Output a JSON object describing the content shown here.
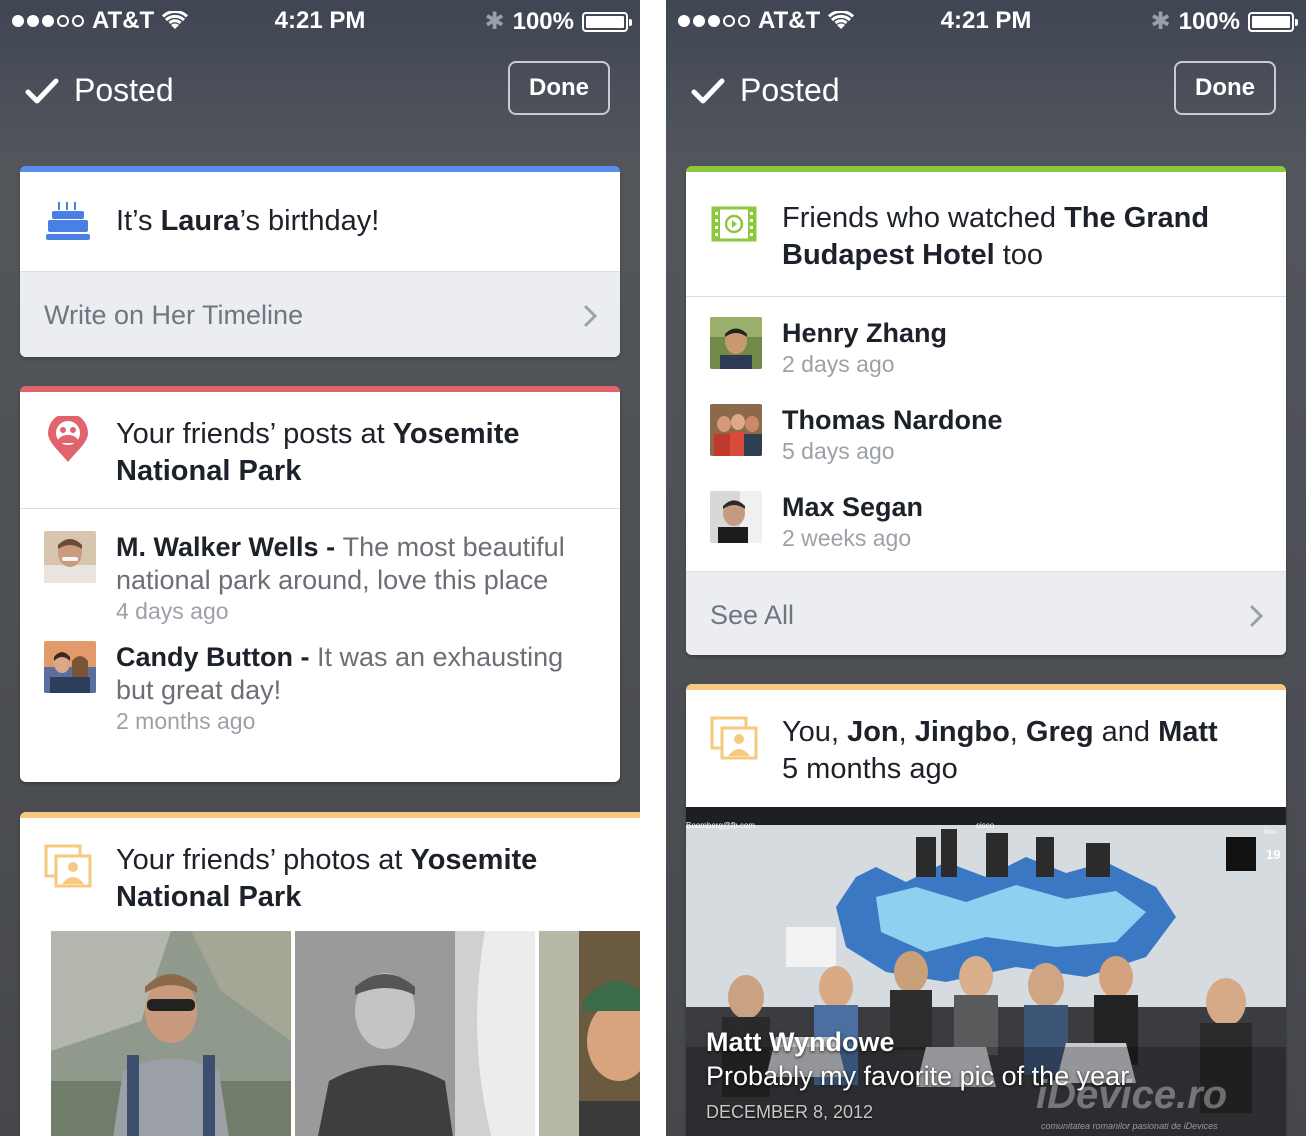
{
  "status_bar": {
    "carrier": "AT&T",
    "time": "4:21 PM",
    "battery": "100%",
    "signal_bars_filled": 3,
    "signal_bars_total": 5
  },
  "navbar": {
    "title": "Posted",
    "done_label": "Done"
  },
  "left": {
    "birthday_card": {
      "accent": "#5b8def",
      "prefix": "It’s ",
      "name": "Laura",
      "suffix": "’s birthday!",
      "action": "Write on Her Timeline"
    },
    "posts_card": {
      "accent": "#e0636d",
      "prefix": "Your friends’ posts at ",
      "place": "Yosemite National Park",
      "posts": [
        {
          "name": "M. Walker Wells",
          "text": "The most beautiful national park around, love this place",
          "time": "4 days ago"
        },
        {
          "name": "Candy Button",
          "text": "It was an exhausting but great day!",
          "time": "2 months ago"
        }
      ]
    },
    "photos_card": {
      "accent": "#f6c97f",
      "prefix": "Your friends’ photos at ",
      "place": "Yosemite National Park"
    }
  },
  "right": {
    "movie_card": {
      "accent": "#8cc83c",
      "prefix": "Friends who watched ",
      "movie": "The Grand Budapest Hotel",
      "suffix": " too",
      "friends": [
        {
          "name": "Henry Zhang",
          "time": "2 days ago"
        },
        {
          "name": "Thomas Nardone",
          "time": "5 days ago"
        },
        {
          "name": "Max Segan",
          "time": "2 weeks ago"
        }
      ],
      "action": "See All"
    },
    "memory_card": {
      "accent": "#f6c97f",
      "people_you": "You",
      "people_1": "Jon",
      "people_2": "Jingbo",
      "people_3": "Greg",
      "people_4": "Matt",
      "sep_comma": ", ",
      "sep_and": " and ",
      "time": "5 months ago",
      "photo_author": "Matt Wyndowe",
      "photo_caption": "Probably my favorite pic of the year",
      "photo_date": "DECEMBER 8, 2012",
      "screen_email": "Boomberg@fb.com",
      "screen_brand": "cisco",
      "calendar_month": "Nov",
      "calendar_day": "19",
      "watermark": "iDevice.ro",
      "watermark_sub": "comunitatea romanilor pasionati de iDevices"
    }
  }
}
